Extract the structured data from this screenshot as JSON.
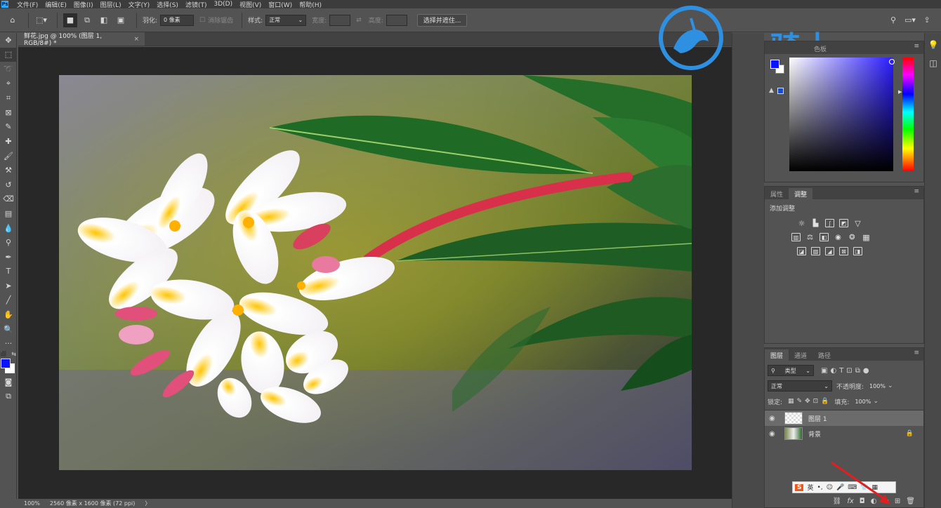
{
  "menu": {
    "logo": "Ps",
    "items": [
      "文件(F)",
      "编辑(E)",
      "图像(I)",
      "图层(L)",
      "文字(Y)",
      "选择(S)",
      "滤镜(T)",
      "3D(D)",
      "视图(V)",
      "窗口(W)",
      "帮助(H)"
    ]
  },
  "options": {
    "feather_label": "羽化:",
    "feather_value": "0 像素",
    "antialias_label": "消除锯齿",
    "style_label": "样式:",
    "style_value": "正常",
    "width_label": "宽度:",
    "height_label": "高度:",
    "select_mask_button": "选择并遮住..."
  },
  "document": {
    "tab_title": "鲜花.jpg @ 100% (图层 1, RGB/8#) *",
    "close": "×"
  },
  "status": {
    "zoom": "100%",
    "dimensions": "2560 像素 x 1600 像素 (72 ppi)",
    "arrow": "〉"
  },
  "color_panel": {
    "tab_partial": "色板",
    "fg_color": "#0a14ff",
    "bg_color": "#ffffff"
  },
  "adjustments_panel": {
    "tabs": [
      "属性",
      "调整"
    ],
    "active_tab": "调整",
    "heading": "添加调整"
  },
  "layers_panel": {
    "tabs": [
      "图层",
      "通道",
      "路径"
    ],
    "filter_kind": "类型",
    "blend_mode": "正常",
    "opacity_label": "不透明度:",
    "opacity_value": "100%",
    "lock_label": "锁定:",
    "fill_label": "填充:",
    "fill_value": "100%",
    "layers": [
      {
        "name": "图层 1",
        "selected": true
      },
      {
        "name": "背景",
        "selected": false
      }
    ],
    "footer_fx": "fx"
  },
  "watermark": {
    "text": "云骑士",
    "color": "#2f8fe0"
  },
  "ime": {
    "s_label": "S",
    "lang": "英"
  }
}
